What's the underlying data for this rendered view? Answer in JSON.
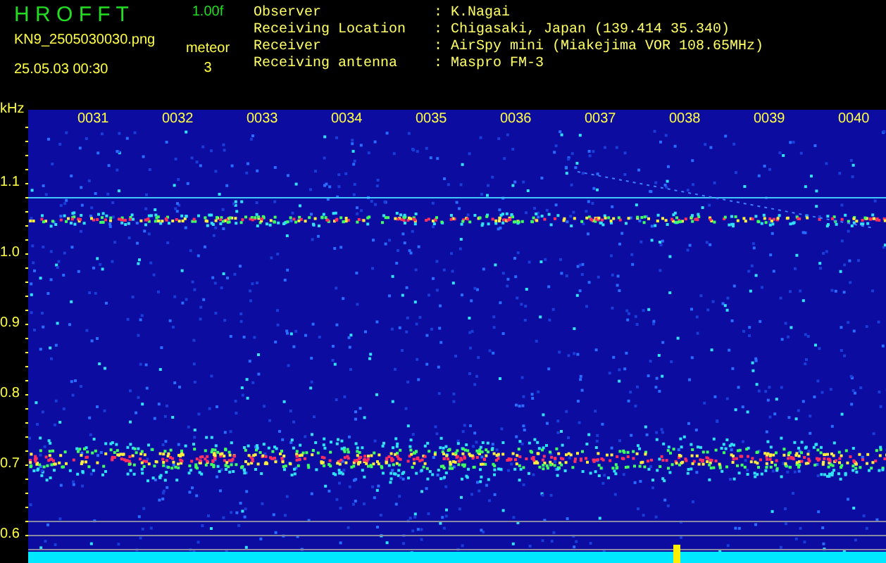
{
  "header": {
    "title": "H R O F F T",
    "version": "1.00f",
    "filename": "KN9_2505030030.png",
    "datetime": "25.05.03 00:30",
    "mode": "meteor",
    "count": "3"
  },
  "info": [
    {
      "label": "Observer",
      "separator": ":",
      "value": "K.Nagai"
    },
    {
      "label": "Receiving Location",
      "separator": ":",
      "value": "Chigasaki, Japan (139.414 35.340)"
    },
    {
      "label": "Receiver",
      "separator": ":",
      "value": "AirSpy mini (Miakejima VOR 108.65MHz)"
    },
    {
      "label": "Receiving antenna",
      "separator": ":",
      "value": "Maspro FM-3"
    }
  ],
  "spectrogram": {
    "unit": "kHz",
    "yticks": [
      "1.1",
      "1.0",
      "0.9",
      "0.8",
      "0.7",
      "0.6"
    ],
    "time_labels": [
      "0031",
      "0032",
      "0033",
      "0034",
      "0035",
      "0036",
      "0037",
      "0038",
      "0039",
      "0040"
    ]
  }
}
